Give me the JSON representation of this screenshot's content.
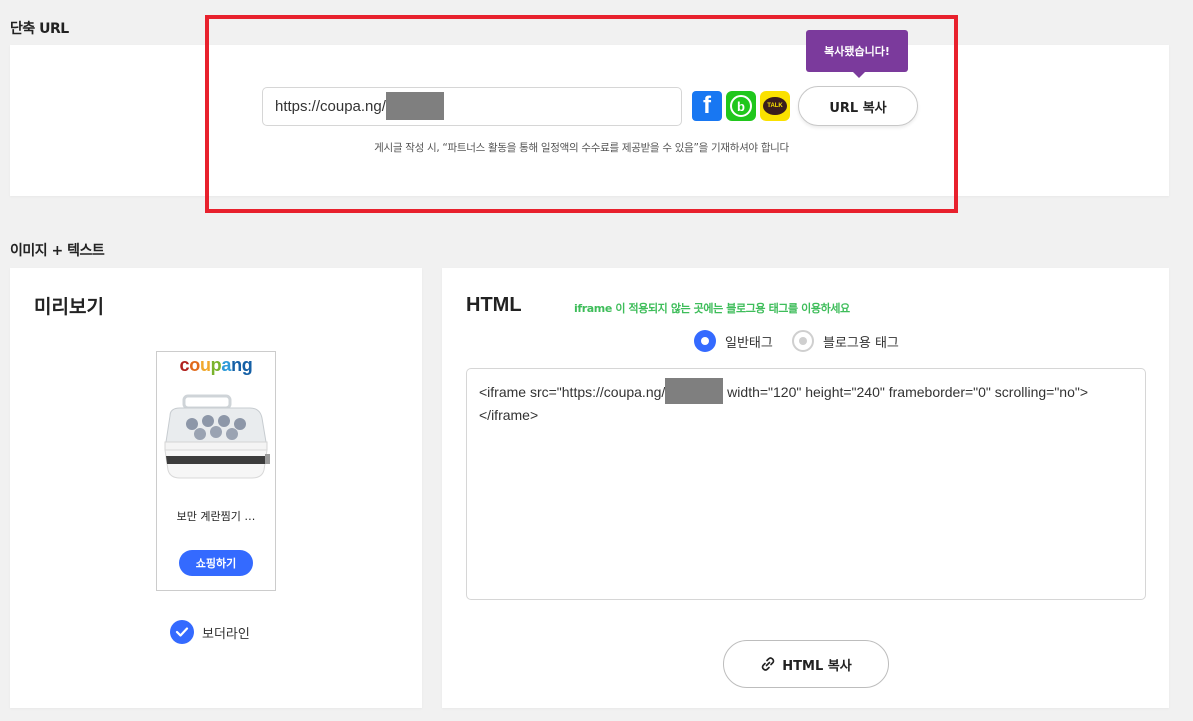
{
  "short_url_section": {
    "title": "단축 URL",
    "url_prefix": "https://coupa.ng/",
    "share_icons": [
      "facebook-icon",
      "band-icon",
      "kakaotalk-icon"
    ],
    "copy_button_label": "URL 복사",
    "tooltip_text": "복사됐습니다!",
    "notice": "게시글 작성 시, “파트너스 활동을 통해 일정액의 수수료를 제공받을 수 있음”을 기재하셔야 합니다"
  },
  "image_text_section": {
    "title": "이미지 + 텍스트",
    "preview": {
      "title": "미리보기",
      "logo_letters": [
        "c",
        "o",
        "u",
        "p",
        "a",
        "ng"
      ],
      "product_name": "보만 계란찜기 …",
      "shop_button_label": "쇼핑하기",
      "border_line_label": "보더라인",
      "border_line_checked": true
    },
    "html": {
      "title": "HTML",
      "hint": "iframe 이 적용되지 않는 곳에는 블로그용 태그를 이용하세요",
      "radio_normal_label": "일반태그",
      "radio_blog_label": "블로그용 태그",
      "selected": "일반태그",
      "code_prefix": "<iframe src=\"https://coupa.ng/",
      "code_suffix": " width=\"120\" height=\"240\" frameborder=\"0\" scrolling=\"no\"></iframe>",
      "copy_button_label": "HTML 복사"
    }
  },
  "colors": {
    "accent": "#346aff",
    "highlight_border": "#e8212d",
    "tooltip_bg": "#7b3a9c",
    "hint_green": "#3ebd5a"
  }
}
